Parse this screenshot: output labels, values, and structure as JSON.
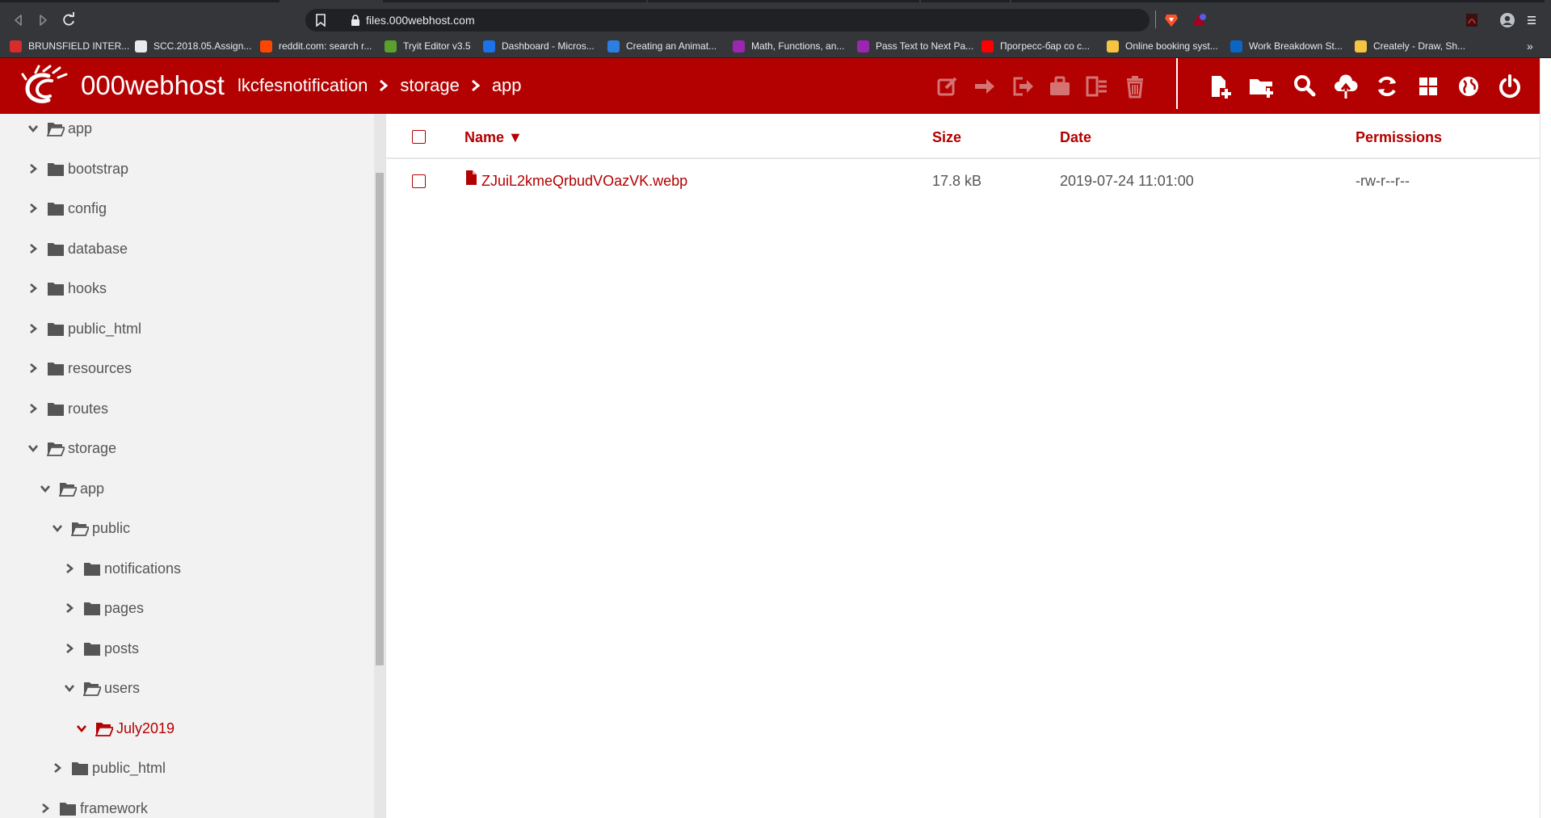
{
  "browser": {
    "url": "files.000webhost.com",
    "bookmarks": [
      {
        "label": "BRUNSFIELD INTER...",
        "color": "#d92b2b"
      },
      {
        "label": "SCC.2018.05.Assign...",
        "color": "#e8eaed"
      },
      {
        "label": "reddit.com: search r...",
        "color": "#ff4500"
      },
      {
        "label": "Tryit Editor v3.5",
        "color": "#5aa02c"
      },
      {
        "label": "Dashboard - Micros...",
        "color": "#1a73e8"
      },
      {
        "label": "Creating an Animat...",
        "color": "#2b7fe0"
      },
      {
        "label": "Math, Functions, an...",
        "color": "#9b27b0"
      },
      {
        "label": "Pass Text to Next Pa...",
        "color": "#9b27b0"
      },
      {
        "label": "Прогресс-бар со с...",
        "color": "#ff0000"
      },
      {
        "label": "Online booking syst...",
        "color": "#f5c542"
      },
      {
        "label": "Work Breakdown St...",
        "color": "#0a66c2"
      },
      {
        "label": "Creately - Draw, Sh...",
        "color": "#f5c542"
      }
    ]
  },
  "header": {
    "brand": "000webhost",
    "breadcrumb": [
      "lkcfesnotification",
      "storage",
      "app"
    ],
    "bg_color": "#b30000"
  },
  "sidebar": {
    "tree": [
      {
        "label": "app",
        "depth": 0,
        "expanded": true
      },
      {
        "label": "bootstrap",
        "depth": 0,
        "expanded": false
      },
      {
        "label": "config",
        "depth": 0,
        "expanded": false
      },
      {
        "label": "database",
        "depth": 0,
        "expanded": false
      },
      {
        "label": "hooks",
        "depth": 0,
        "expanded": false
      },
      {
        "label": "public_html",
        "depth": 0,
        "expanded": false
      },
      {
        "label": "resources",
        "depth": 0,
        "expanded": false
      },
      {
        "label": "routes",
        "depth": 0,
        "expanded": false
      },
      {
        "label": "storage",
        "depth": 0,
        "expanded": true
      },
      {
        "label": "app",
        "depth": 1,
        "expanded": true
      },
      {
        "label": "public",
        "depth": 2,
        "expanded": true
      },
      {
        "label": "notifications",
        "depth": 3,
        "expanded": false
      },
      {
        "label": "pages",
        "depth": 3,
        "expanded": false
      },
      {
        "label": "posts",
        "depth": 3,
        "expanded": false
      },
      {
        "label": "users",
        "depth": 3,
        "expanded": true
      },
      {
        "label": "July2019",
        "depth": 4,
        "expanded": true,
        "current": true
      },
      {
        "label": "public_html",
        "depth": 2,
        "expanded": false
      },
      {
        "label": "framework",
        "depth": 1,
        "expanded": false
      }
    ]
  },
  "list": {
    "columns": {
      "name": "Name",
      "size": "Size",
      "date": "Date",
      "permissions": "Permissions"
    },
    "sort_indicator": "▼",
    "rows": [
      {
        "name": "ZJuiL2kmeQrbudVOazVK.webp",
        "size": "17.8 kB",
        "date": "2019-07-24 11:01:00",
        "permissions": "-rw-r--r--"
      }
    ]
  }
}
